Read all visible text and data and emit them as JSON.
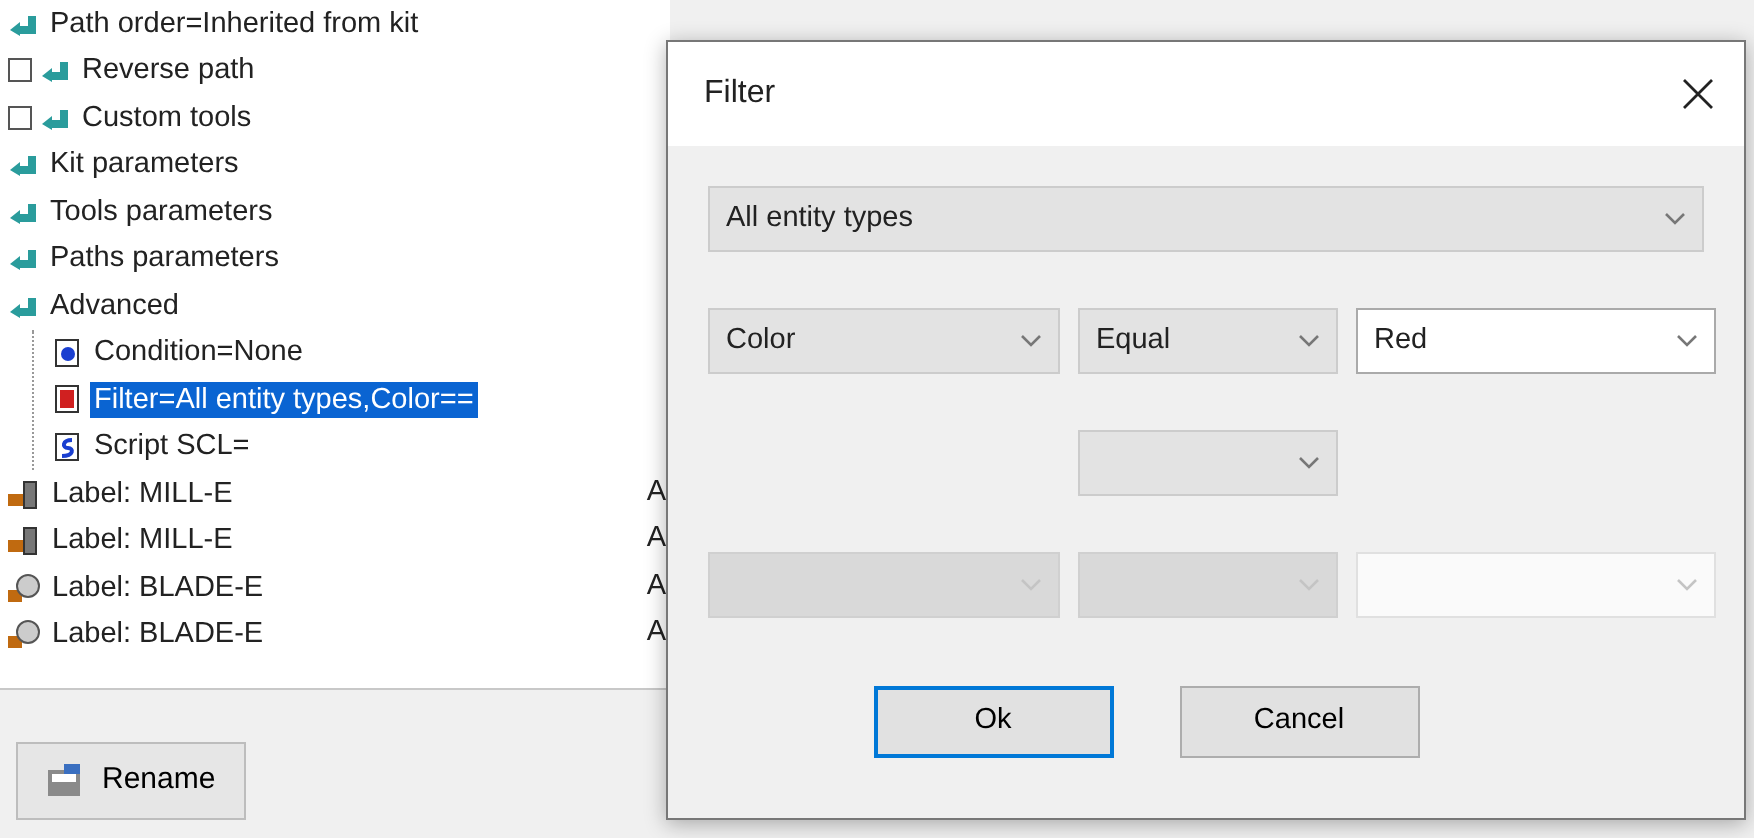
{
  "tree": {
    "items": [
      {
        "kind": "plain",
        "label": "Path order=Inherited from kit",
        "selected": false
      },
      {
        "kind": "checkbox",
        "label": "Reverse path",
        "checked": false,
        "selected": false
      },
      {
        "kind": "checkbox",
        "label": "Custom tools",
        "checked": false,
        "selected": false
      },
      {
        "kind": "plain",
        "label": "Kit parameters",
        "selected": false
      },
      {
        "kind": "plain",
        "label": "Tools parameters",
        "selected": false
      },
      {
        "kind": "plain",
        "label": "Paths parameters",
        "selected": false
      },
      {
        "kind": "plain",
        "label": "Advanced",
        "selected": false,
        "children": [
          {
            "kind": "condition",
            "label": "Condition=None",
            "selected": false
          },
          {
            "kind": "filter",
            "label": "Filter=All entity types,Color==",
            "selected": true
          },
          {
            "kind": "script",
            "label": "Script SCL=",
            "selected": false
          }
        ]
      }
    ]
  },
  "entries": [
    {
      "kind": "mill",
      "label": "Label: MILL-E",
      "column_2": "A"
    },
    {
      "kind": "mill",
      "label": "Label: MILL-E",
      "column_2": "A"
    },
    {
      "kind": "blade",
      "label": "Label: BLADE-E",
      "column_2": "A"
    },
    {
      "kind": "blade",
      "label": "Label: BLADE-E",
      "column_2": "A"
    }
  ],
  "rename_button": {
    "label": "Rename"
  },
  "dialog": {
    "title": "Filter",
    "entity_type": {
      "value": "All entity types"
    },
    "rows": [
      {
        "kind": "condition",
        "disabled": false,
        "field": {
          "value": "Color"
        },
        "operator": {
          "value": "Equal"
        },
        "value": {
          "value": "Red"
        }
      },
      {
        "kind": "connector",
        "disabled": false
      },
      {
        "kind": "condition",
        "disabled": true
      }
    ],
    "buttons": [
      {
        "label": "Ok",
        "default": true
      },
      {
        "label": "Cancel",
        "default": false
      }
    ]
  }
}
